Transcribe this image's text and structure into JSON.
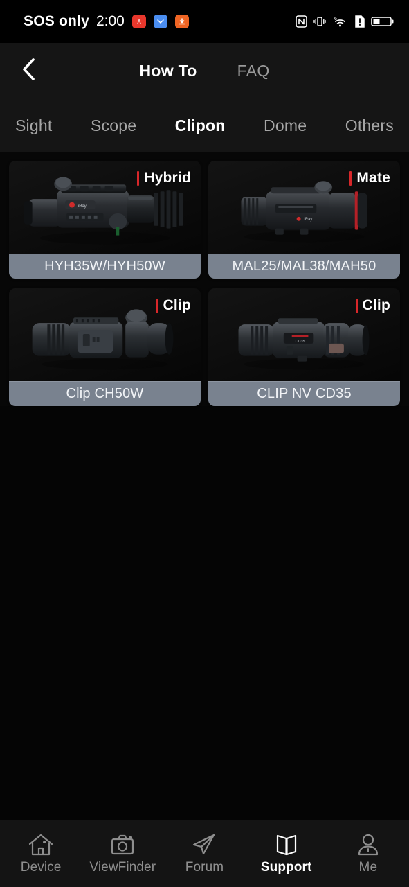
{
  "statusbar": {
    "carrier": "SOS only",
    "time": "2:00",
    "app_icons": [
      {
        "name": "alarm-app-icon",
        "color": "#e8372c"
      },
      {
        "name": "mail-app-icon",
        "color": "#4a8df0"
      },
      {
        "name": "download-app-icon",
        "color": "#ef6524"
      }
    ],
    "right_icons": [
      {
        "name": "nfc-icon"
      },
      {
        "name": "vibrate-icon"
      },
      {
        "name": "wifi-6-icon"
      },
      {
        "name": "sim-alert-icon"
      },
      {
        "name": "battery-icon"
      }
    ]
  },
  "header": {
    "back_icon": "chevron-left-icon",
    "segments": [
      {
        "label": "How To",
        "active": true
      },
      {
        "label": "FAQ",
        "active": false
      }
    ]
  },
  "category_tabs": [
    {
      "label": "Sight",
      "active": false
    },
    {
      "label": "Scope",
      "active": false
    },
    {
      "label": "Clipon",
      "active": true
    },
    {
      "label": "Dome",
      "active": false
    },
    {
      "label": "Others",
      "active": false
    }
  ],
  "products": [
    {
      "badge": "Hybrid",
      "name": "HYH35W/HYH50W",
      "variant": "hybrid"
    },
    {
      "badge": "Mate",
      "name": "MAL25/MAL38/MAH50",
      "variant": "mate"
    },
    {
      "badge": "Clip",
      "name": "Clip CH50W",
      "variant": "clip-ch50w"
    },
    {
      "badge": "Clip",
      "name": "CLIP NV CD35",
      "variant": "clip-cd35"
    }
  ],
  "bottom_nav": [
    {
      "label": "Device",
      "icon": "home-icon",
      "active": false
    },
    {
      "label": "ViewFinder",
      "icon": "camera-icon",
      "active": false
    },
    {
      "label": "Forum",
      "icon": "paper-plane-icon",
      "active": false
    },
    {
      "label": "Support",
      "icon": "open-book-icon",
      "active": true
    },
    {
      "label": "Me",
      "icon": "person-icon",
      "active": false
    }
  ],
  "colors": {
    "accent_red": "#d8272a",
    "card_label_bg": "#79828f",
    "background": "#070707"
  }
}
